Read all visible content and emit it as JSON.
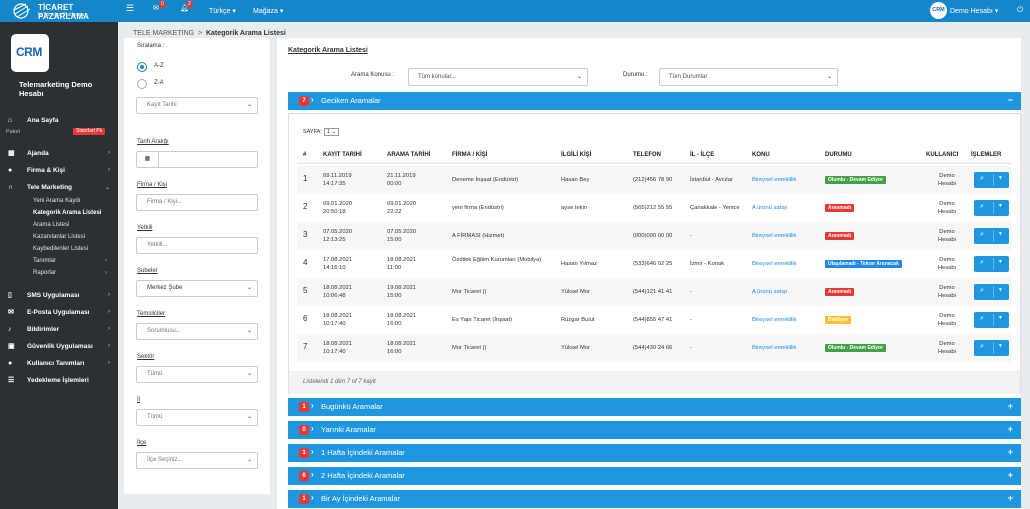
{
  "topbar": {
    "logo_title": "TİCARET PAZARLAMA",
    "logo_sub": "İş Yönetim Platformu",
    "mail_count": "0",
    "notif_count": "2",
    "language": "Türkçe ▾",
    "store": "Mağaza ▾",
    "user": "Demo Hesabı ▾",
    "colors": {
      "topbar": "#1586c9",
      "accent": "#1e97e0",
      "danger": "#e53935"
    }
  },
  "sidebar": {
    "logo": "CRM",
    "brand": "Telemarketing Demo Hesabı",
    "home": "Ana Sayfa",
    "package_label": "Paket",
    "package_badge": "Standart Pk",
    "items": [
      {
        "label": "Ajanda",
        "icon": "calendar-icon"
      },
      {
        "label": "Firma & Kişi",
        "icon": "user-icon"
      },
      {
        "label": "Tele Marketing",
        "icon": "headset-icon"
      }
    ],
    "tele_sub": [
      "Yeni Arama Kaydı",
      "Kategorik Arama Listesi",
      "Arama Listesi",
      "Kazanılanlar Listesi",
      "Kaybedilenler Listesi",
      "Tanımlar",
      "Raporlar"
    ],
    "items2": [
      {
        "label": "SMS Uygulaması",
        "icon": "mobile-icon"
      },
      {
        "label": "E-Posta Uygulaması",
        "icon": "envelope-icon"
      },
      {
        "label": "Bildirimler",
        "icon": "bell-icon"
      },
      {
        "label": "Güvenlik Uygulaması",
        "icon": "lock-icon"
      },
      {
        "label": "Kullanıcı Tanımları",
        "icon": "users-icon"
      },
      {
        "label": "Yedekleme İşlemleri",
        "icon": "database-icon"
      }
    ]
  },
  "breadcrumb": {
    "parent": "TELE MARKETING",
    "sep": ">",
    "current": "Kategorik Arama Listesi"
  },
  "filters": {
    "sort_label": "Sıralama :",
    "radio_az": "A-Z",
    "radio_za": "Z-A",
    "sort_field": "Kayıt Tarihi",
    "date_label": "Tarih Aralığı",
    "firm_label": "Firma / Kişi",
    "firm_placeholder": "Firma / Kişi...",
    "auth_label": "Yetkili",
    "auth_placeholder": "Yetkili...",
    "branch_label": "Şubeler",
    "branch_value": "Merkez Şube",
    "rep_label": "Temsilciler",
    "rep_value": "Sorumlusu...",
    "sector_label": "Sektör",
    "sector_value": "Tümü",
    "city_label": "İl",
    "city_value": "Tümü",
    "district_label": "İlçe",
    "district_value": "İlçe Seçiniz..."
  },
  "main": {
    "title": "Kategorik Arama Listesi",
    "topic_label": "Arama Konusu :",
    "topic_value": "Tüm konular...",
    "status_label": "Durumu :",
    "status_value": "Tüm Durumlar",
    "page_label": "SAYFA:",
    "page_value": "1",
    "headers": [
      "#",
      "KAYIT TARİHİ",
      "ARAMA TARİHİ",
      "FİRMA / KİŞİ",
      "İLGİLİ KİŞİ",
      "TELEFON",
      "İL - İLÇE",
      "KONU",
      "DURUMU",
      "KULLANICI",
      "İŞLEMLER"
    ],
    "rows": [
      {
        "no": "1",
        "kayit": [
          "09.11.2019",
          "14:17:35"
        ],
        "arama": [
          "21.11.2019",
          "00:00"
        ],
        "firma": "Deneme İnşaat (Endüstri)",
        "ilgili": "Hasan Bey",
        "tel": "(212)456 78 90",
        "il": "İstanbul - Avcılar",
        "konu": "Bireysel emeklilik",
        "durum": "Olumlu - Devam Ediyor",
        "durum_color": "#43a047",
        "kul": [
          "Demo",
          "Hesabı"
        ]
      },
      {
        "no": "2",
        "kayit": [
          "09.01.2020",
          "20:50:18"
        ],
        "arama": [
          "09.01.2020",
          "22:22"
        ],
        "firma": "yeni firma (Endüstri)",
        "ilgili": "ayse tekin",
        "tel": "(565)212 55 55",
        "il": "Çanakkale - Yenice",
        "konu": "A ürünü satışı",
        "durum": "Aranmadı",
        "durum_color": "#e53935",
        "kul": [
          "Demo",
          "Hesabı"
        ]
      },
      {
        "no": "3",
        "kayit": [
          "07.05.2020",
          "12:13:25"
        ],
        "arama": [
          "07.05.2020",
          "15:00"
        ],
        "firma": "A FİRMASI (Hizmet)",
        "ilgili": "",
        "tel": "(000)000 00 00",
        "il": "-",
        "konu": "Bireysel emeklilik",
        "durum": "Aranmadı",
        "durum_color": "#e53935",
        "kul": [
          "Demo",
          "Hesabı"
        ]
      },
      {
        "no": "4",
        "kayit": [
          "17.08.2021",
          "14:16:10"
        ],
        "arama": [
          "18.08.2021",
          "11:00"
        ],
        "firma": "Özdilek Eğitim Kurumları (Mobilya)",
        "ilgili": "Hasan Yılmaz",
        "tel": "(533)646 02 25",
        "il": "İzmir - Konak",
        "konu": "Bireysel emeklilik",
        "durum": "Ulaşılamadı - Tekrar Aranacak",
        "durum_color": "#1e88e5",
        "kul": [
          "Demo",
          "Hesabı"
        ]
      },
      {
        "no": "5",
        "kayit": [
          "18.08.2021",
          "10:06:48"
        ],
        "arama": [
          "19.08.2021",
          "15:00"
        ],
        "firma": "Mor Ticaret ()",
        "ilgili": "Yüksel Mor",
        "tel": "(544)121 41 41",
        "il": "-",
        "konu": "A ürünü satışı",
        "durum": "Aranmadı",
        "durum_color": "#e53935",
        "kul": [
          "Demo",
          "Hesabı"
        ]
      },
      {
        "no": "6",
        "kayit": [
          "18.08.2021",
          "10:17:40"
        ],
        "arama": [
          "18.08.2021",
          "16:00"
        ],
        "firma": "Es Yapı Ticaret (İnşaat)",
        "ilgili": "Rüzgar Bulut",
        "tel": "(544)855 47 41",
        "il": "-",
        "konu": "Bireysel emeklilik",
        "durum": "Bekliyor",
        "durum_color": "#fbc02d",
        "kul": [
          "Demo",
          "Hesabı"
        ]
      },
      {
        "no": "7",
        "kayit": [
          "18.08.2021",
          "10:17:40"
        ],
        "arama": [
          "18.08.2021",
          "16:00"
        ],
        "firma": "Mor Ticaret ()",
        "ilgili": "Yüksel Mor",
        "tel": "(544)430 24 66",
        "il": "-",
        "konu": "Bireysel emeklilik",
        "durum": "Olumlu - Devam Ediyor",
        "durum_color": "#43a047",
        "kul": [
          "Demo",
          "Hesabı"
        ]
      }
    ],
    "footer": "Listelendi 1 den 7 of 7 kayit",
    "sections": [
      {
        "count": "7",
        "title": "Geciken Aramalar",
        "toggle": "−"
      },
      {
        "count": "1",
        "title": "Bugünkü Aramalar",
        "toggle": "+"
      },
      {
        "count": "0",
        "title": "Yarınki Aramalar",
        "toggle": "+"
      },
      {
        "count": "1",
        "title": "1 Hafta İçindeki Aramalar",
        "toggle": "+"
      },
      {
        "count": "6",
        "title": "2 Hafta İçindeki Aramalar",
        "toggle": "+"
      },
      {
        "count": "1",
        "title": "Bir Ay İçindeki Aramalar",
        "toggle": "+"
      }
    ]
  }
}
